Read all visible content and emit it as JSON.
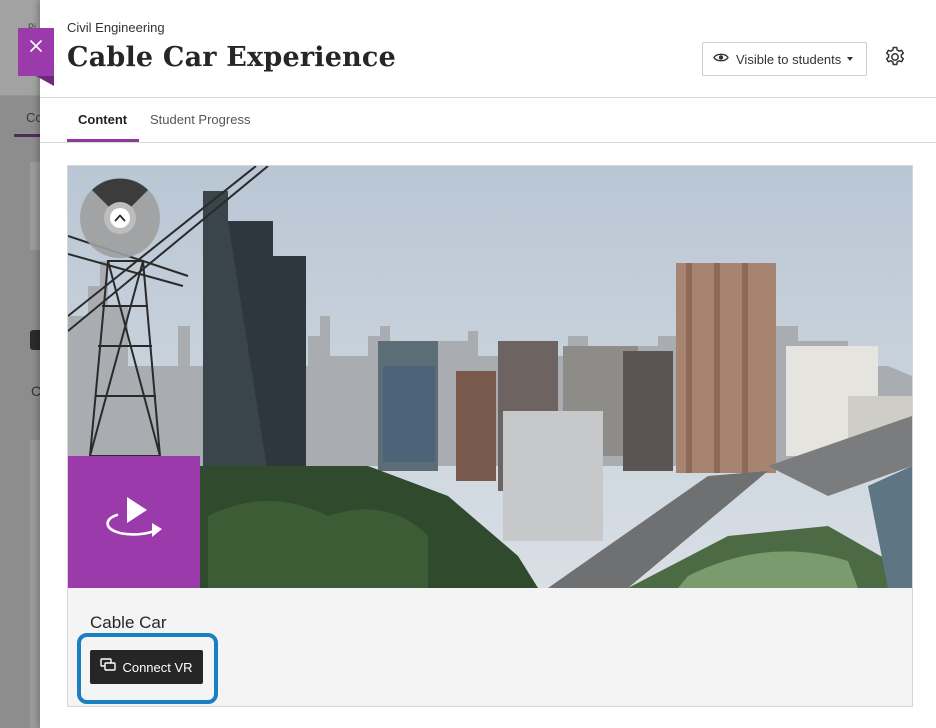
{
  "header": {
    "course": "Civil Engineering",
    "title": "Cable Car Experience",
    "visibility_label": "Visible to students"
  },
  "tabs": [
    {
      "label": "Content",
      "active": true
    },
    {
      "label": "Student Progress",
      "active": false
    }
  ],
  "background_page": {
    "tab_fragment": "Co",
    "small_text": "Pi",
    "letter": "C"
  },
  "item": {
    "title": "Cable Car",
    "connect_label": "Connect VR"
  },
  "icons": {
    "close": "close-icon",
    "visibility": "eye-icon",
    "dropdown": "caret-down-icon",
    "settings": "gear-icon",
    "compass": "compass-icon",
    "play360": "play-360-icon",
    "vr": "vr-headset-icon"
  },
  "colors": {
    "accent_purple": "#9b3bab",
    "tab_underline": "#8b3c97",
    "highlight_blue": "#1a7fc1",
    "button_dark": "#262626"
  }
}
